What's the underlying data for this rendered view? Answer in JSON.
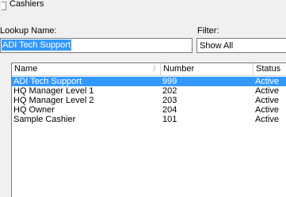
{
  "window": {
    "title": "Cashiers"
  },
  "lookup": {
    "label": "Lookup Name:",
    "value": "ADI Tech Support"
  },
  "filter": {
    "label": "Filter:",
    "selected": "Show All"
  },
  "list": {
    "columns": {
      "name": "Name",
      "number": "Number",
      "status": "Status",
      "sort_indicator": "/"
    },
    "rows": [
      {
        "name": "ADI Tech Support",
        "number": "999",
        "status": "Active"
      },
      {
        "name": "HQ Manager Level 1",
        "number": "202",
        "status": "Active"
      },
      {
        "name": "HQ Manager Level 2",
        "number": "203",
        "status": "Active"
      },
      {
        "name": "HQ Owner",
        "number": "204",
        "status": "Active"
      },
      {
        "name": "Sample Cashier",
        "number": "101",
        "status": "Active"
      }
    ],
    "selected_index": 0
  },
  "colors": {
    "selection": "#3399ff",
    "window_bg": "#f0f0f0"
  }
}
